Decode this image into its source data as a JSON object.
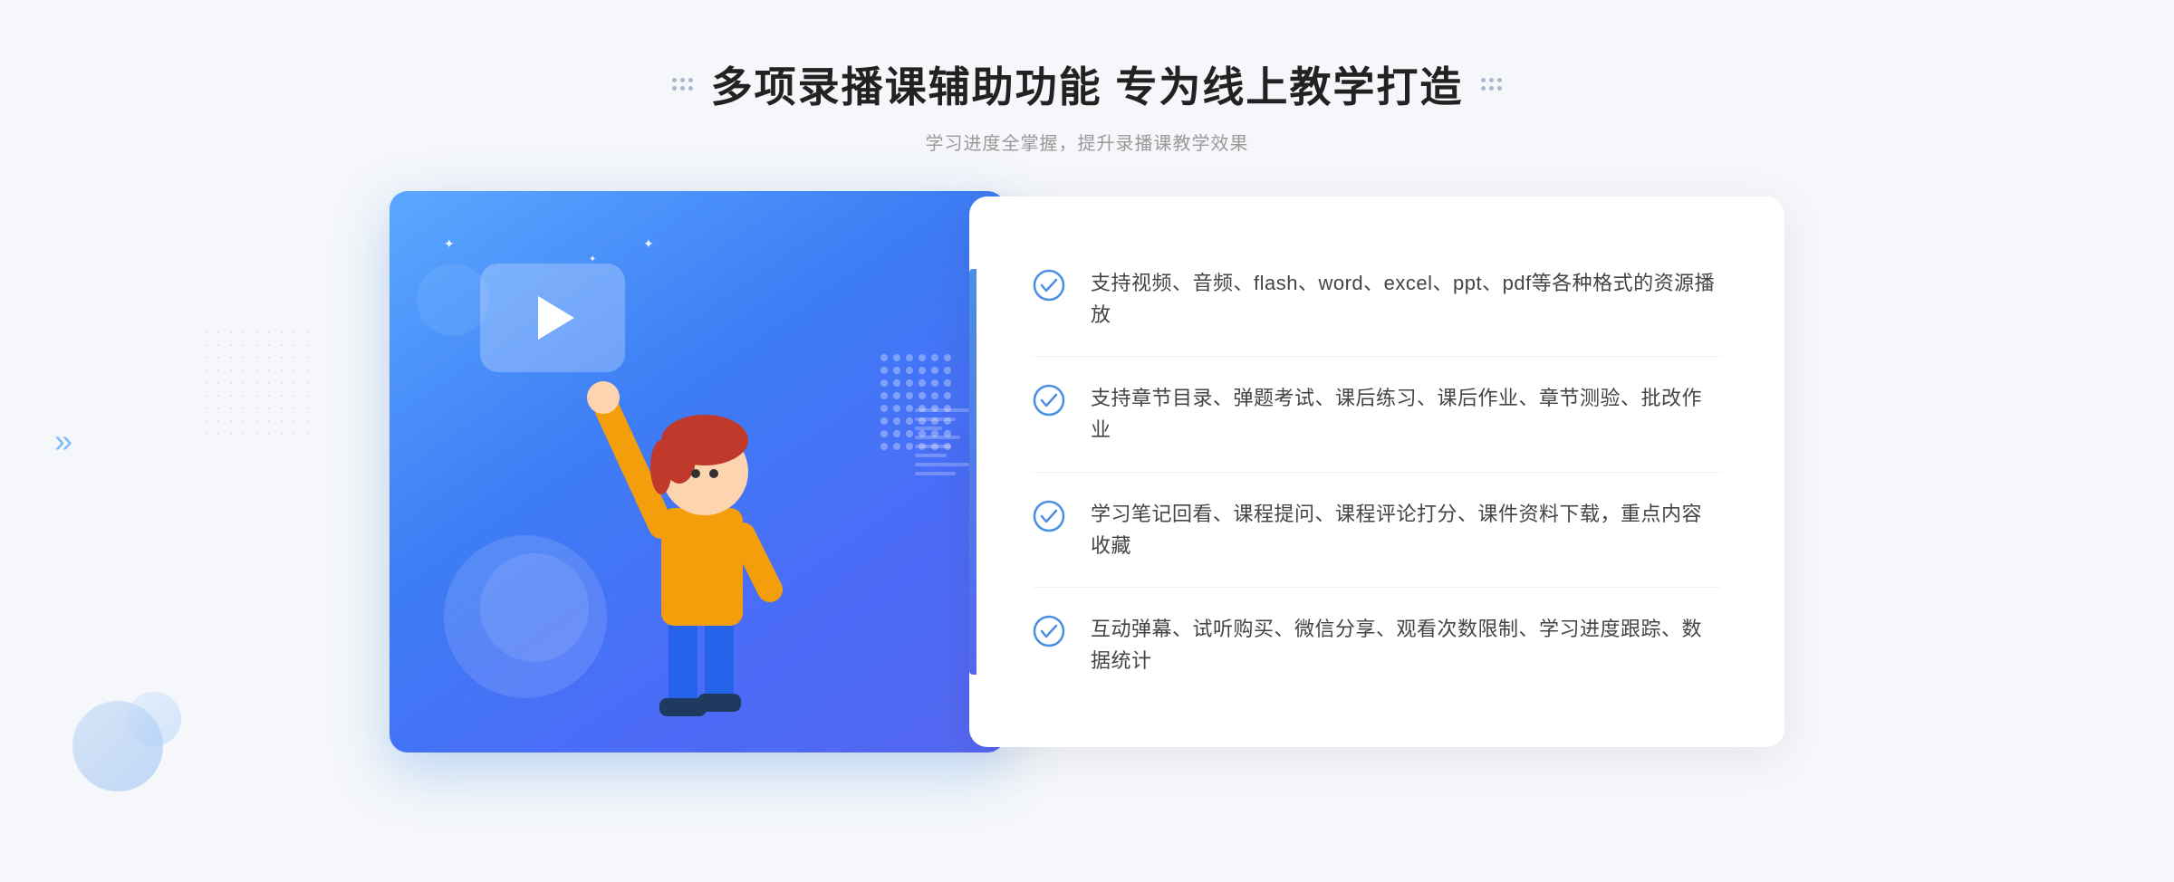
{
  "header": {
    "title": "多项录播课辅助功能 专为线上教学打造",
    "subtitle": "学习进度全掌握，提升录播课教学效果",
    "left_decorator": "⁞⁞",
    "right_decorator": "⁞⁞"
  },
  "features": [
    {
      "id": 1,
      "text": "支持视频、音频、flash、word、excel、ppt、pdf等各种格式的资源播放"
    },
    {
      "id": 2,
      "text": "支持章节目录、弹题考试、课后练习、课后作业、章节测验、批改作业"
    },
    {
      "id": 3,
      "text": "学习笔记回看、课程提问、课程评论打分、课件资料下载，重点内容收藏"
    },
    {
      "id": 4,
      "text": "互动弹幕、试听购买、微信分享、观看次数限制、学习进度跟踪、数据统计"
    }
  ],
  "decorators": {
    "chevron": "»",
    "play_button": "▶"
  },
  "colors": {
    "primary_blue": "#4a90e2",
    "gradient_start": "#5ba8ff",
    "gradient_end": "#5567f0",
    "check_color": "#4a90e2",
    "text_dark": "#222222",
    "text_gray": "#999999",
    "text_feature": "#444444"
  }
}
